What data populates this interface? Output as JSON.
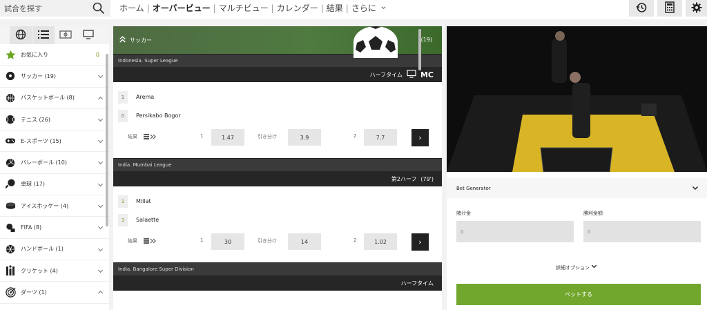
{
  "search": {
    "placeholder": "試合を探す"
  },
  "nav": {
    "items": [
      "ホーム",
      "オーバービュー",
      "マルチビュー",
      "カレンダー",
      "結果",
      "さらに"
    ]
  },
  "toolbar": {
    "icons": [
      "history-icon",
      "calculator-icon",
      "gear-icon"
    ]
  },
  "sidebar": {
    "items": [
      {
        "label": "お気に入り",
        "count": "0"
      },
      {
        "label": "サッカー (19)"
      },
      {
        "label": "バスケットボール (8)"
      },
      {
        "label": "テニス (26)"
      },
      {
        "label": "E-スポーツ (15)"
      },
      {
        "label": "バレーボール (10)"
      },
      {
        "label": "卓球 (17)"
      },
      {
        "label": "アイスホッケー (4)"
      },
      {
        "label": "FIFA (8)"
      },
      {
        "label": "ハンドボール (1)"
      },
      {
        "label": "クリケット (4)"
      },
      {
        "label": "ダーツ (1)"
      }
    ]
  },
  "main": {
    "sport": "サッカー",
    "sport_count": "(19)",
    "matches": [
      {
        "league": "Indonesia. Super League",
        "period": "ハーフタイム",
        "period_extra": "MC",
        "team1_score": "1",
        "team1": "Arema",
        "team2_score": "0",
        "team2": "Persikabo Bogor",
        "result_label": "結果",
        "odd1_label": "1",
        "odd1": "1.47",
        "draw_label": "引き分け",
        "draw": "3.9",
        "odd2_label": "2",
        "odd2": "7.7"
      },
      {
        "league": "India. Mumbai League",
        "period": "第2ハーフ",
        "period_extra": "(79')",
        "team1_score": "1",
        "team1": "Millat",
        "team2_score": "3",
        "team2": "Salaette",
        "result_label": "結果",
        "odd1_label": "1",
        "odd1": "30",
        "draw_label": "引き分け",
        "draw": "14",
        "odd2_label": "2",
        "odd2": "1.02"
      },
      {
        "league": "India. Bangalore Super Division",
        "period": "ハーフタイム"
      }
    ]
  },
  "betslip": {
    "title": "Bet Generator",
    "stake_label": "賭け金",
    "stake_value": "0",
    "win_label": "勝利金額",
    "win_value": "0",
    "advanced": "詳細オプション",
    "bet_button": "ベットする"
  },
  "colors": {
    "accent": "#72a72e",
    "dark": "#262626"
  }
}
